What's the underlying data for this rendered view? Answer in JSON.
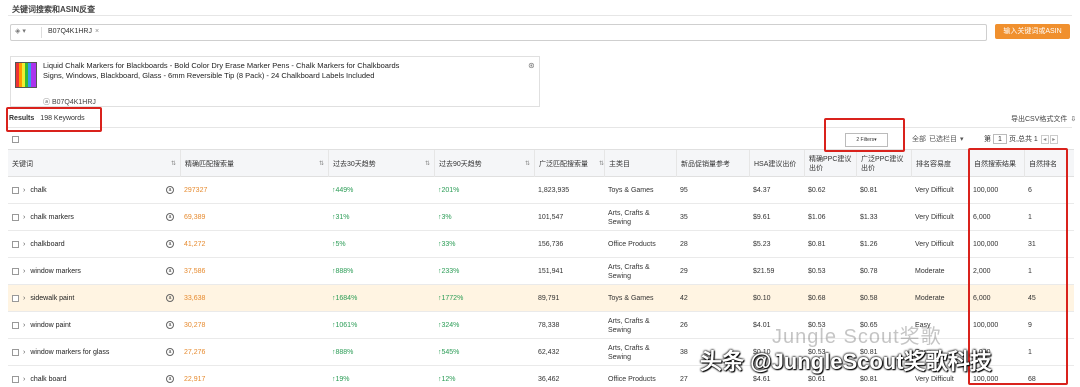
{
  "header": {
    "title": "关键词搜索和ASIN反查"
  },
  "search": {
    "marketplace": "▾",
    "asin_tag": "B07Q4K1HRJ",
    "remove": "×",
    "button": "输入关键词或ASIN"
  },
  "product": {
    "title": "Liquid Chalk Markers for Blackboards - Bold Color Dry Erase Marker Pens - Chalk Markers for Chalkboards Signs, Windows, Blackboard, Glass - 6mm Reversible Tip (8 Pack) - 24 Chalkboard Labels Included",
    "asin": "B07Q4K1HRJ"
  },
  "results": {
    "label": "Results",
    "count": "198 Keywords"
  },
  "toolbar": {
    "export": "导出CSV格式文件",
    "export_icon": "⇩",
    "filters_label": "2 Filters",
    "filters_caret": "▾",
    "select_all": "全部",
    "selected": "已选栏目",
    "selected_caret": "▾",
    "page_prefix": "第",
    "page_value": "1",
    "page_suffix": "页,总共 1",
    "prev": "◂",
    "next": "▸"
  },
  "table": {
    "headers": [
      "关键词",
      "精确匹配搜索量",
      "过去30天趋势",
      "过去90天趋势",
      "广泛匹配搜索量",
      "主类目",
      "新品促销量参考",
      "HSA建议出价",
      "精确PPC建议出价",
      "广泛PPC建议出价",
      "排名容易度",
      "自然搜索结果",
      "自然排名"
    ],
    "rows": [
      {
        "keyword": "chalk",
        "exact": "297327",
        "t30": "↑449%",
        "t90": "↑201%",
        "broad": "1,823,935",
        "category": "Toys & Games",
        "promo": "95",
        "hsa": "$4.37",
        "ppc_exact": "$0.62",
        "ppc_broad": "$0.81",
        "ease": "Very Difficult",
        "organic": "100,000",
        "rank": "6"
      },
      {
        "keyword": "chalk markers",
        "exact": "69,389",
        "t30": "↑31%",
        "t90": "↑3%",
        "broad": "101,547",
        "category": "Arts, Crafts & Sewing",
        "promo": "35",
        "hsa": "$9.61",
        "ppc_exact": "$1.06",
        "ppc_broad": "$1.33",
        "ease": "Very Difficult",
        "organic": "6,000",
        "rank": "1"
      },
      {
        "keyword": "chalkboard",
        "exact": "41,272",
        "t30": "↑5%",
        "t90": "↑33%",
        "broad": "156,736",
        "category": "Office Products",
        "promo": "28",
        "hsa": "$5.23",
        "ppc_exact": "$0.81",
        "ppc_broad": "$1.26",
        "ease": "Very Difficult",
        "organic": "100,000",
        "rank": "31"
      },
      {
        "keyword": "window markers",
        "exact": "37,586",
        "t30": "↑888%",
        "t90": "↑233%",
        "broad": "151,941",
        "category": "Arts, Crafts & Sewing",
        "promo": "29",
        "hsa": "$21.59",
        "ppc_exact": "$0.53",
        "ppc_broad": "$0.78",
        "ease": "Moderate",
        "organic": "2,000",
        "rank": "1"
      },
      {
        "keyword": "sidewalk paint",
        "exact": "33,638",
        "t30": "↑1684%",
        "t90": "↑1772%",
        "broad": "89,791",
        "category": "Toys & Games",
        "promo": "42",
        "hsa": "$0.10",
        "ppc_exact": "$0.68",
        "ppc_broad": "$0.58",
        "ease": "Moderate",
        "organic": "6,000",
        "rank": "45"
      },
      {
        "keyword": "window paint",
        "exact": "30,278",
        "t30": "↑1061%",
        "t90": "↑324%",
        "broad": "78,338",
        "category": "Arts, Crafts & Sewing",
        "promo": "26",
        "hsa": "$4.01",
        "ppc_exact": "$0.53",
        "ppc_broad": "$0.65",
        "ease": "Easy",
        "organic": "100,000",
        "rank": "9"
      },
      {
        "keyword": "window markers for glass",
        "exact": "27,276",
        "t30": "↑888%",
        "t90": "↑545%",
        "broad": "62,432",
        "category": "Arts, Crafts & Sewing",
        "promo": "38",
        "hsa": "$0.10",
        "ppc_exact": "$0.53",
        "ppc_broad": "$0.81",
        "ease": "Easy",
        "organic": "1,000",
        "rank": "1"
      },
      {
        "keyword": "chalk board",
        "exact": "22,917",
        "t30": "↑19%",
        "t90": "↑12%",
        "broad": "36,462",
        "category": "Office Products",
        "promo": "27",
        "hsa": "$4.61",
        "ppc_exact": "$0.61",
        "ppc_broad": "$0.81",
        "ease": "Very Difficult",
        "organic": "100,000",
        "rank": "68"
      }
    ]
  },
  "watermark": {
    "line1": "Jungle Scout奖歌",
    "line2": "头条 @JungleScout奖歌科技"
  },
  "colors": {
    "accent": "#f0902e",
    "highlight": "#d9221c",
    "trend_up": "#2a9c55",
    "volume": "#e68a2e"
  }
}
